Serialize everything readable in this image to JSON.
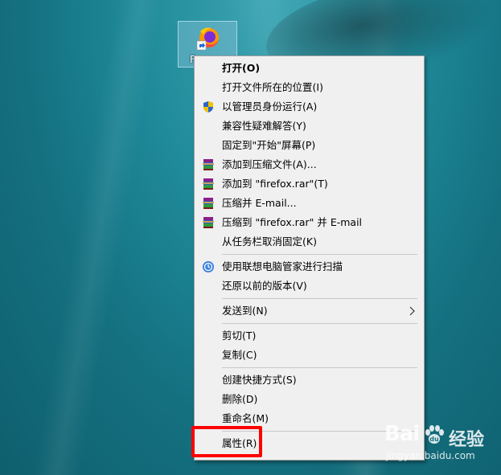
{
  "desktop": {
    "icon_label": "F"
  },
  "menu": {
    "items": [
      {
        "label": "打开(O)",
        "icon": "none",
        "bold": true
      },
      {
        "label": "打开文件所在的位置(I)",
        "icon": "none"
      },
      {
        "label": "以管理员身份运行(A)",
        "icon": "uac-shield-icon"
      },
      {
        "label": "兼容性疑难解答(Y)",
        "icon": "none"
      },
      {
        "label": "固定到\"开始\"屏幕(P)",
        "icon": "none"
      },
      {
        "label": "添加到压缩文件(A)...",
        "icon": "winrar-icon"
      },
      {
        "label": "添加到 \"firefox.rar\"(T)",
        "icon": "winrar-icon"
      },
      {
        "label": "压缩并 E-mail...",
        "icon": "winrar-icon"
      },
      {
        "label": "压缩到 \"firefox.rar\" 并 E-mail",
        "icon": "winrar-icon"
      },
      {
        "label": "从任务栏取消固定(K)",
        "icon": "none"
      },
      {
        "label": "使用联想电脑管家进行扫描",
        "icon": "lenovo-scan-icon"
      },
      {
        "label": "还原以前的版本(V)",
        "icon": "none"
      },
      {
        "label": "发送到(N)",
        "icon": "none",
        "submenu": true
      },
      {
        "label": "剪切(T)",
        "icon": "none"
      },
      {
        "label": "复制(C)",
        "icon": "none"
      },
      {
        "label": "创建快捷方式(S)",
        "icon": "none"
      },
      {
        "label": "删除(D)",
        "icon": "none"
      },
      {
        "label": "重命名(M)",
        "icon": "none"
      },
      {
        "label": "属性(R)",
        "icon": "none",
        "highlighted": true
      }
    ]
  },
  "watermark": {
    "brand": "Bai",
    "brand2": "经验",
    "url": "jingyan.baidu.com"
  },
  "colors": {
    "highlight_border": "#ff0000",
    "menu_bg": "#f0f0f0"
  }
}
